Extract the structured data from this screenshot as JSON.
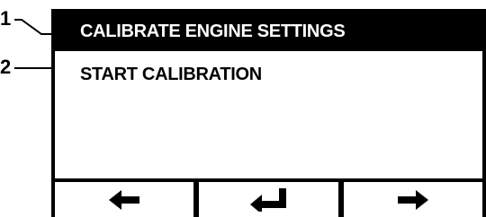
{
  "callouts": [
    {
      "number": "1"
    },
    {
      "number": "2"
    }
  ],
  "display": {
    "title": "CALIBRATE ENGINE SETTINGS",
    "menu_item": "START CALIBRATION"
  },
  "softkeys": [
    {
      "icon": "arrow-left-icon"
    },
    {
      "icon": "enter-icon"
    },
    {
      "icon": "arrow-right-icon"
    }
  ]
}
